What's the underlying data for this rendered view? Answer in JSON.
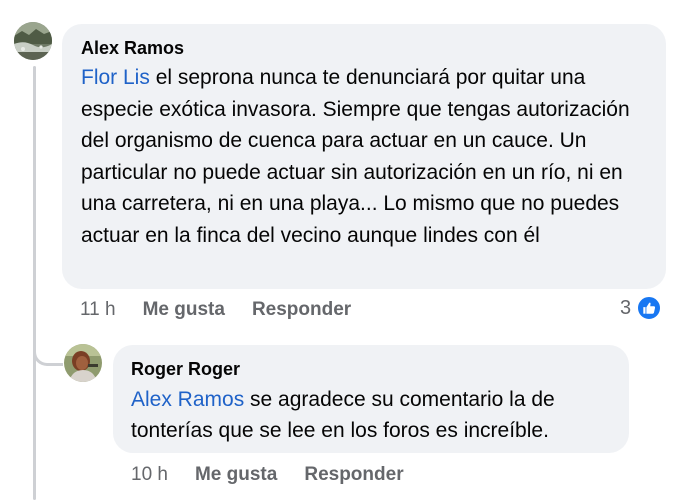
{
  "comments": [
    {
      "author": "Alex Ramos",
      "mention": "Flor Lis",
      "text": " el seprona nunca te denunciará por quitar una especie exótica invasora. Siempre que tengas autorización del organismo de cuenca para actuar en un cauce. Un particular no puede actuar sin autorización en un río, ni en una carretera, ni en una playa... Lo mismo que no puedes actuar en la finca del vecino aunque lindes con él",
      "time": "11 h",
      "like_label": "Me gusta",
      "reply_label": "Responder",
      "reaction_count": "3",
      "reaction_icon": "like-icon",
      "avatar_icon": "landscape-avatar"
    },
    {
      "author": "Roger Roger",
      "mention": "Alex Ramos",
      "text": " se agradece su comentario la de tonterías que se lee en los foros es increíble.",
      "time": "10 h",
      "like_label": "Me gusta",
      "reply_label": "Responder",
      "avatar_icon": "portrait-avatar"
    }
  ],
  "colors": {
    "bubble": "#f0f2f5",
    "mention": "#1f62c8",
    "meta": "#65676b",
    "like_blue": "#1877f2",
    "thread_line": "#ced0d4"
  }
}
